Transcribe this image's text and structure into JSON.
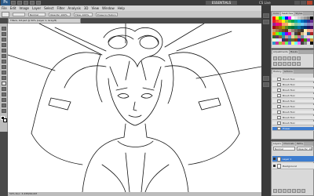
{
  "app": {
    "logo": "Ps",
    "workspace": "ESSENTIALS",
    "cs_live": "CS Live"
  },
  "menu": [
    "File",
    "Edit",
    "Image",
    "Layer",
    "Select",
    "Filter",
    "Analysis",
    "3D",
    "View",
    "Window",
    "Help"
  ],
  "options": {
    "mode": "Normal",
    "opacity": "Opacity: 100%",
    "flow": "Flow: 100%",
    "erase_to_history": "Erase to History"
  },
  "document": {
    "tab_title": "Tifanii, Kit.psd @ 50% (Layer 1, Gray/8)",
    "status": "50%   Doc: 3.43M/64.0M"
  },
  "panels": {
    "swatches_tabs": [
      "Color",
      "Swatches",
      "Styles"
    ],
    "adjust_tabs": [
      "Adjustments",
      "Masks"
    ],
    "history_tabs": [
      "History",
      "Actions"
    ],
    "history_items": [
      "Brush Tool",
      "Brush Tool",
      "Brush Tool",
      "Brush Tool",
      "Brush Tool",
      "Brush Tool",
      "Brush Tool",
      "Brush Tool",
      "Brush Tool",
      "Eraser"
    ],
    "layers_tabs": [
      "Layers",
      "Channels",
      "Paths"
    ],
    "blend_mode": "Normal",
    "opacity_label": "Opacity: 100%",
    "layers": [
      "Layer 1",
      "Background"
    ]
  },
  "swatch_colors": [
    "#ff0000",
    "#ffff00",
    "#00ff00",
    "#00ffff",
    "#0000ff",
    "#ff00ff",
    "#ffffff",
    "#e6e6e6",
    "#cccccc",
    "#b3b3b3",
    "#999999",
    "#808080",
    "#000000",
    "#ed1c24",
    "#f26522",
    "#f7941d",
    "#fff200",
    "#8dc63f",
    "#39b54a",
    "#00a651",
    "#00a99d",
    "#00aeef",
    "#0072bc",
    "#0054a6",
    "#2e3192",
    "#662d91",
    "#92278f",
    "#ec008c",
    "#ed145b",
    "#f69679",
    "#fbaf5d",
    "#fff799",
    "#c4df9b",
    "#82ca9c",
    "#7accc8",
    "#6dcff6",
    "#7da7d9",
    "#8781bd",
    "#a186be",
    "#9e0b0f",
    "#a0410d",
    "#a36209",
    "#aba000",
    "#598527",
    "#1a7b30",
    "#007236",
    "#00746b",
    "#0076a3",
    "#004a80",
    "#003471",
    "#1b1464",
    "#440e62",
    "#c69c6d",
    "#a67c52",
    "#8c6239",
    "#754c24",
    "#603813",
    "#c7b299",
    "#998675",
    "#736357",
    "#534741",
    "#362f2d",
    "#fbf3b6",
    "#f9ad81",
    "#f5989d",
    "#ff7f00",
    "#7fff00",
    "#00ff7f",
    "#007fff",
    "#7f00ff",
    "#ff007f",
    "#bfbfbf",
    "#404040",
    "#5a2d0c",
    "#d4b483",
    "#f4e7c5",
    "#2a5d8a",
    "#aa2222",
    "#336633",
    "#663366",
    "#996633",
    "#339999",
    "#cc9999",
    "#6699cc",
    "#ffcc99",
    "#99cc66",
    "#cc6699",
    "#669999",
    "#ccccff",
    "#ffcccc",
    "#ccffcc",
    "#ffffcc",
    "#ccffff",
    "#ffccff",
    "#333366",
    "#663333",
    "#336666",
    "#666633",
    "#993300",
    "#003399",
    "#990033",
    "#339900",
    "#9933cc",
    "#cc9933",
    "#3399cc",
    "#cc3399",
    "#99cc33",
    "#ff6666",
    "#66ff66",
    "#6666ff",
    "#ffff66",
    "#66ffff",
    "#ff66ff",
    "#444444",
    "#888888",
    "#dddddd",
    "#101010"
  ]
}
